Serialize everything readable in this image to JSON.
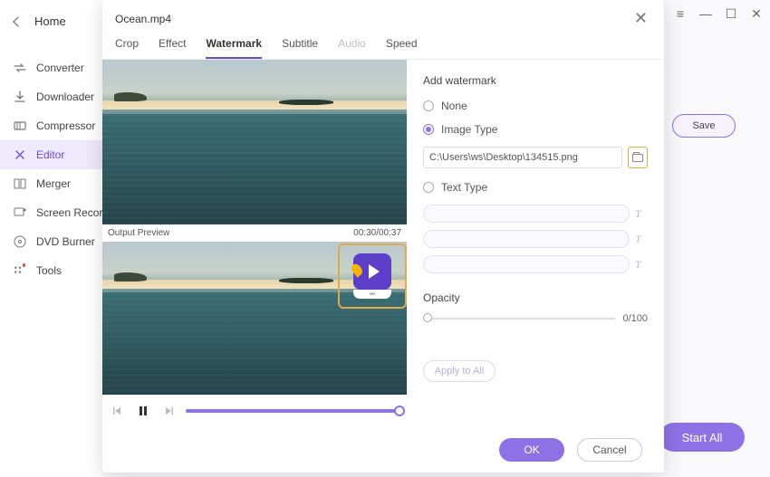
{
  "nav": {
    "home": "Home",
    "items": [
      {
        "label": "Converter"
      },
      {
        "label": "Downloader"
      },
      {
        "label": "Compressor"
      },
      {
        "label": "Editor"
      },
      {
        "label": "Merger"
      },
      {
        "label": "Screen Recorder"
      },
      {
        "label": "DVD Burner"
      },
      {
        "label": "Tools"
      }
    ]
  },
  "bg": {
    "save": "Save",
    "start_all": "Start All"
  },
  "dialog": {
    "title": "Ocean.mp4",
    "tabs": [
      {
        "label": "Crop"
      },
      {
        "label": "Effect"
      },
      {
        "label": "Watermark"
      },
      {
        "label": "Subtitle"
      },
      {
        "label": "Audio"
      },
      {
        "label": "Speed"
      }
    ],
    "preview_label": "Output Preview",
    "timecode": "00:30/00:37",
    "wm": {
      "section": "Add watermark",
      "none": "None",
      "image_type": "Image Type",
      "path": "C:\\Users\\ws\\Desktop\\134515.png",
      "text_type": "Text Type",
      "opacity_label": "Opacity",
      "opacity_value": "0/100",
      "apply_all": "Apply to All"
    },
    "ok": "OK",
    "cancel": "Cancel"
  }
}
